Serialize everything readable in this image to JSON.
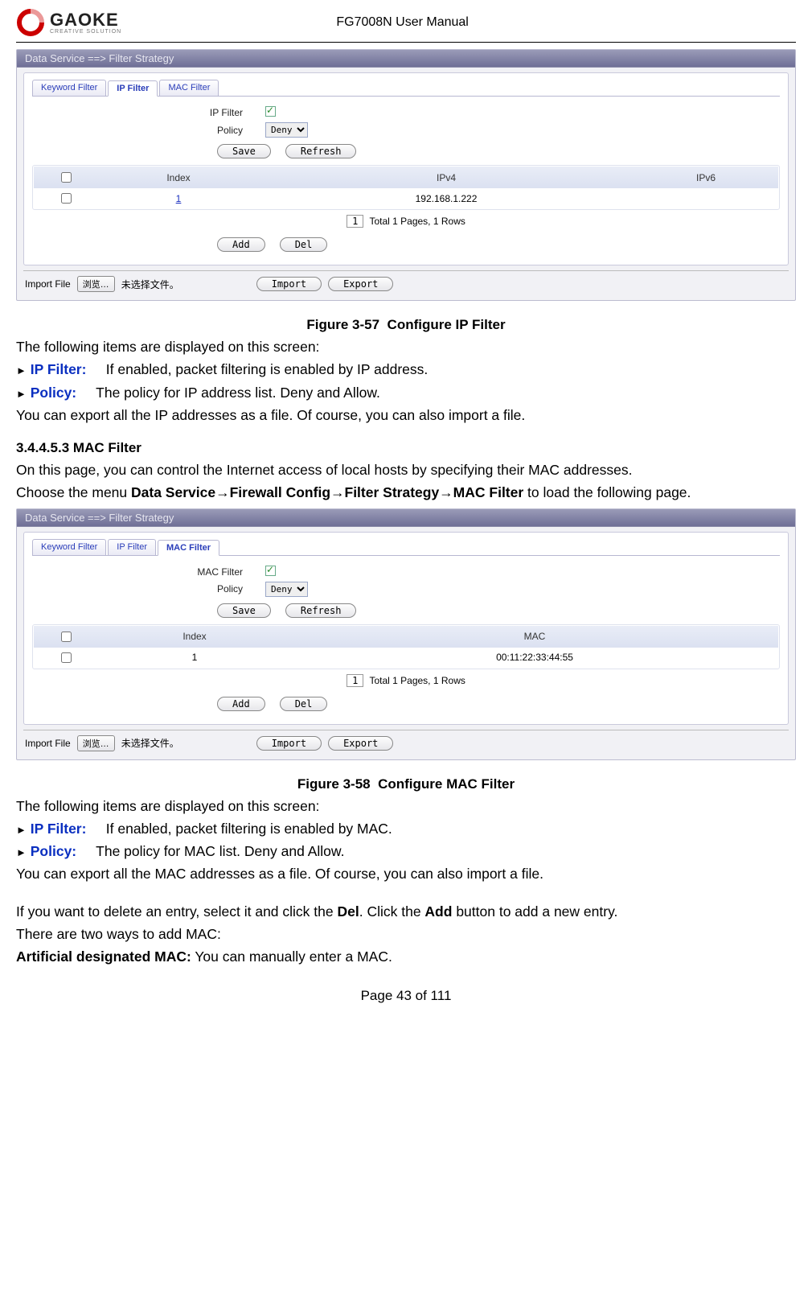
{
  "header": {
    "logo_text": "GAOKE",
    "logo_sub": "CREATIVE SOLUTION",
    "doc_title": "FG7008N User Manual"
  },
  "shot1": {
    "title": "Data Service ==> Filter Strategy",
    "tabs": {
      "kw": "Keyword Filter",
      "ip": "IP Filter",
      "mac": "MAC Filter"
    },
    "lbl_ipfilter": "IP Filter",
    "lbl_policy": "Policy",
    "policy_value": "Deny",
    "btn_save": "Save",
    "btn_refresh": "Refresh",
    "th_index": "Index",
    "th_ipv4": "IPv4",
    "th_ipv6": "IPv6",
    "row_index": "1",
    "row_ipv4": "192.168.1.222",
    "pagebox": "1",
    "pagetext": "Total 1 Pages, 1 Rows",
    "btn_add": "Add",
    "btn_del": "Del",
    "import_lbl": "Import File",
    "browse": "浏览…",
    "nofile": "未选择文件。",
    "btn_import": "Import",
    "btn_export": "Export"
  },
  "fig57": {
    "num": "Figure 3-57",
    "title": "Configure IP Filter"
  },
  "desc1": {
    "intro": "The following items are displayed on this screen:",
    "marker": "►",
    "ip_label": "IP Filter:",
    "ip_text": "If enabled, packet filtering is enabled by IP address.",
    "policy_label": "Policy:",
    "policy_text": "The policy for IP address list. Deny and Allow.",
    "export_note": "You can export all the IP addresses as a file. Of course, you can also import a file."
  },
  "sect345": {
    "num": "3.4.4.5.3",
    "title": "MAC Filter",
    "para1": "On this page, you can control the Internet access of local hosts by specifying their MAC addresses.",
    "para2a": "Choose the menu ",
    "para2b": "Data Service→Firewall Config→Filter Strategy→MAC Filter",
    "para2c": " to load the following page."
  },
  "shot2": {
    "title": "Data Service ==> Filter Strategy",
    "tabs": {
      "kw": "Keyword Filter",
      "ip": "IP Filter",
      "mac": "MAC Filter"
    },
    "lbl_macfilter": "MAC Filter",
    "lbl_policy": "Policy",
    "policy_value": "Deny",
    "btn_save": "Save",
    "btn_refresh": "Refresh",
    "th_index": "Index",
    "th_mac": "MAC",
    "row_index": "1",
    "row_mac": "00:11:22:33:44:55",
    "pagebox": "1",
    "pagetext": "Total 1 Pages, 1 Rows",
    "btn_add": "Add",
    "btn_del": "Del",
    "import_lbl": "Import File",
    "browse": "浏览…",
    "nofile": "未选择文件。",
    "btn_import": "Import",
    "btn_export": "Export"
  },
  "fig58": {
    "num": "Figure 3-58",
    "title": "Configure MAC Filter"
  },
  "desc2": {
    "intro": "The following items are displayed on this screen:",
    "marker": "►",
    "ip_label": "IP Filter:",
    "ip_text": "If enabled, packet filtering is enabled by MAC.",
    "policy_label": "Policy:",
    "policy_text": "The policy for MAC list. Deny and Allow.",
    "export_note": "You can export all the MAC addresses as a file. Of course, you can also import a file."
  },
  "tail": {
    "para1a": "If you want to delete an entry, select it and click the ",
    "para1b": "Del",
    "para1c": ". Click the ",
    "para1d": "Add",
    "para1e": " button to add a new entry.",
    "para2": "There are two ways to add MAC:",
    "para3a": "Artificial designated MAC:",
    "para3b": " You can manually enter a MAC."
  },
  "footer": {
    "text": "Page 43 of 111"
  }
}
